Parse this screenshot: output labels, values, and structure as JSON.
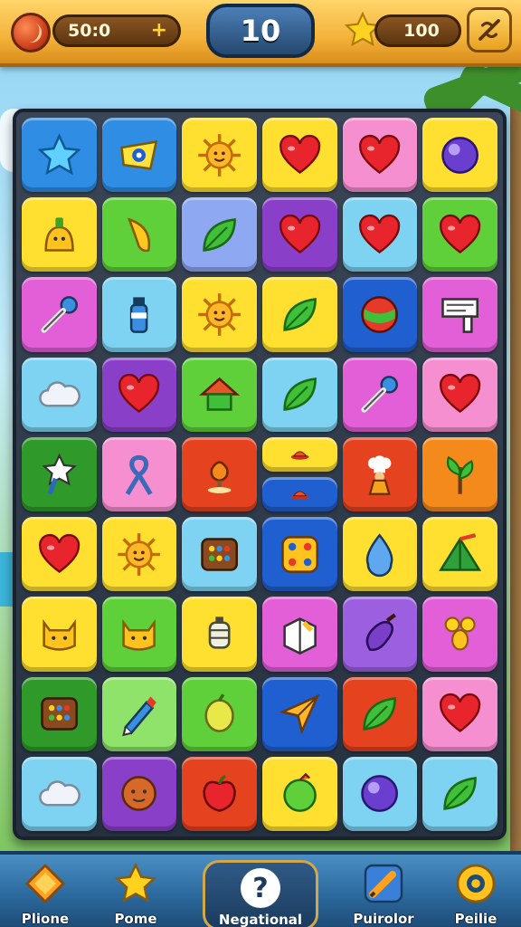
{
  "hud": {
    "coins_value": "50:0",
    "coins_plus": "+",
    "level": "10",
    "stars_value": "100"
  },
  "colors": {
    "blue": "#2f8de4",
    "yellow": "#ffe030",
    "pink": "#f58fd0",
    "magenta": "#e25fd8",
    "green": "#5fcf3a",
    "dkgreen": "#2f9a2a",
    "purple": "#8a3fc9",
    "periwinkle": "#8ea8f2",
    "lightblue": "#7fd3f2",
    "red": "#e5431f",
    "orange": "#f58a1c",
    "dkblue": "#1f5fd0",
    "violet": "#9b5fe0",
    "lightgreen": "#8fe36a",
    "tan": "#ffe87a"
  },
  "board": {
    "rows": [
      [
        {
          "bg": "blue",
          "icon": "star-icon"
        },
        {
          "bg": "blue",
          "icon": "eye-star-icon"
        },
        {
          "bg": "yellow",
          "icon": "sun-face-icon"
        },
        {
          "bg": "yellow",
          "icon": "heart-icon"
        },
        {
          "bg": "pink",
          "icon": "heart-icon"
        },
        {
          "bg": "yellow",
          "icon": "orb-icon"
        }
      ],
      [
        {
          "bg": "yellow",
          "icon": "blob-creature-icon"
        },
        {
          "bg": "green",
          "icon": "banana-icon"
        },
        {
          "bg": "periwinkle",
          "icon": "leaf-icon"
        },
        {
          "bg": "purple",
          "icon": "heart-icon"
        },
        {
          "bg": "lightblue",
          "icon": "heart-icon"
        },
        {
          "bg": "green",
          "icon": "heart-icon"
        }
      ],
      [
        {
          "bg": "magenta",
          "icon": "key-icon"
        },
        {
          "bg": "lightblue",
          "icon": "bottle-icon"
        },
        {
          "bg": "yellow",
          "icon": "sun-face-icon"
        },
        {
          "bg": "yellow",
          "icon": "leaf-icon"
        },
        {
          "bg": "dkblue",
          "icon": "ball-icon"
        },
        {
          "bg": "magenta",
          "icon": "sign-icon"
        }
      ],
      [
        {
          "bg": "lightblue",
          "icon": "cloud-icon"
        },
        {
          "bg": "purple",
          "icon": "heart-icon"
        },
        {
          "bg": "green",
          "icon": "house-icon"
        },
        {
          "bg": "lightblue",
          "icon": "leaf-icon"
        },
        {
          "bg": "magenta",
          "icon": "key-icon"
        },
        {
          "bg": "pink",
          "icon": "heart-icon"
        }
      ],
      [
        {
          "bg": "dkgreen",
          "icon": "star-wand-icon"
        },
        {
          "bg": "pink",
          "icon": "ribbon-icon"
        },
        {
          "bg": "red",
          "icon": "lamp-icon"
        },
        {
          "bg": "yellow",
          "icon": "hat-icon",
          "half": "top"
        },
        {
          "bg": "red",
          "icon": "chef-icon"
        },
        {
          "bg": "orange",
          "icon": "plant-icon"
        }
      ],
      [
        {
          "bg": "yellow",
          "icon": "heart-icon"
        },
        {
          "bg": "yellow",
          "icon": "sun-face-icon"
        },
        {
          "bg": "lightblue",
          "icon": "grid-box-icon"
        },
        {
          "bg": "dkblue",
          "icon": "dice-icon"
        },
        {
          "bg": "yellow",
          "icon": "drop-icon"
        },
        {
          "bg": "yellow",
          "icon": "tent-icon"
        }
      ],
      [
        {
          "bg": "yellow",
          "icon": "cat-face-icon"
        },
        {
          "bg": "green",
          "icon": "cat-face-icon"
        },
        {
          "bg": "yellow",
          "icon": "lantern-icon"
        },
        {
          "bg": "magenta",
          "icon": "block-icon"
        },
        {
          "bg": "violet",
          "icon": "eggplant-icon"
        },
        {
          "bg": "magenta",
          "icon": "balloons-icon"
        }
      ],
      [
        {
          "bg": "dkgreen",
          "icon": "grid-box-icon"
        },
        {
          "bg": "lightgreen",
          "icon": "pencil-icon"
        },
        {
          "bg": "green",
          "icon": "lemon-icon"
        },
        {
          "bg": "dkblue",
          "icon": "plane-icon"
        },
        {
          "bg": "red",
          "icon": "leaf-icon"
        },
        {
          "bg": "pink",
          "icon": "heart-icon"
        }
      ],
      [
        {
          "bg": "lightblue",
          "icon": "cloud-icon"
        },
        {
          "bg": "purple",
          "icon": "cookie-icon"
        },
        {
          "bg": "red",
          "icon": "apple-icon"
        },
        {
          "bg": "yellow",
          "icon": "fruit-icon"
        },
        {
          "bg": "lightblue",
          "icon": "orb-icon"
        },
        {
          "bg": "lightblue",
          "icon": "leaf-icon"
        }
      ]
    ],
    "extra_half_tile": {
      "bg": "dkblue",
      "icon": "hat-icon"
    }
  },
  "nav": {
    "items": [
      {
        "label": "Plione",
        "icon": "diamond-star-icon"
      },
      {
        "label": "Pome",
        "icon": "star-icon"
      },
      {
        "label": "Negational",
        "icon": "question-icon"
      },
      {
        "label": "Puirolor",
        "icon": "pencil-tool-icon"
      },
      {
        "label": "Peilie",
        "icon": "gear-icon"
      }
    ],
    "center_symbol": "?"
  }
}
